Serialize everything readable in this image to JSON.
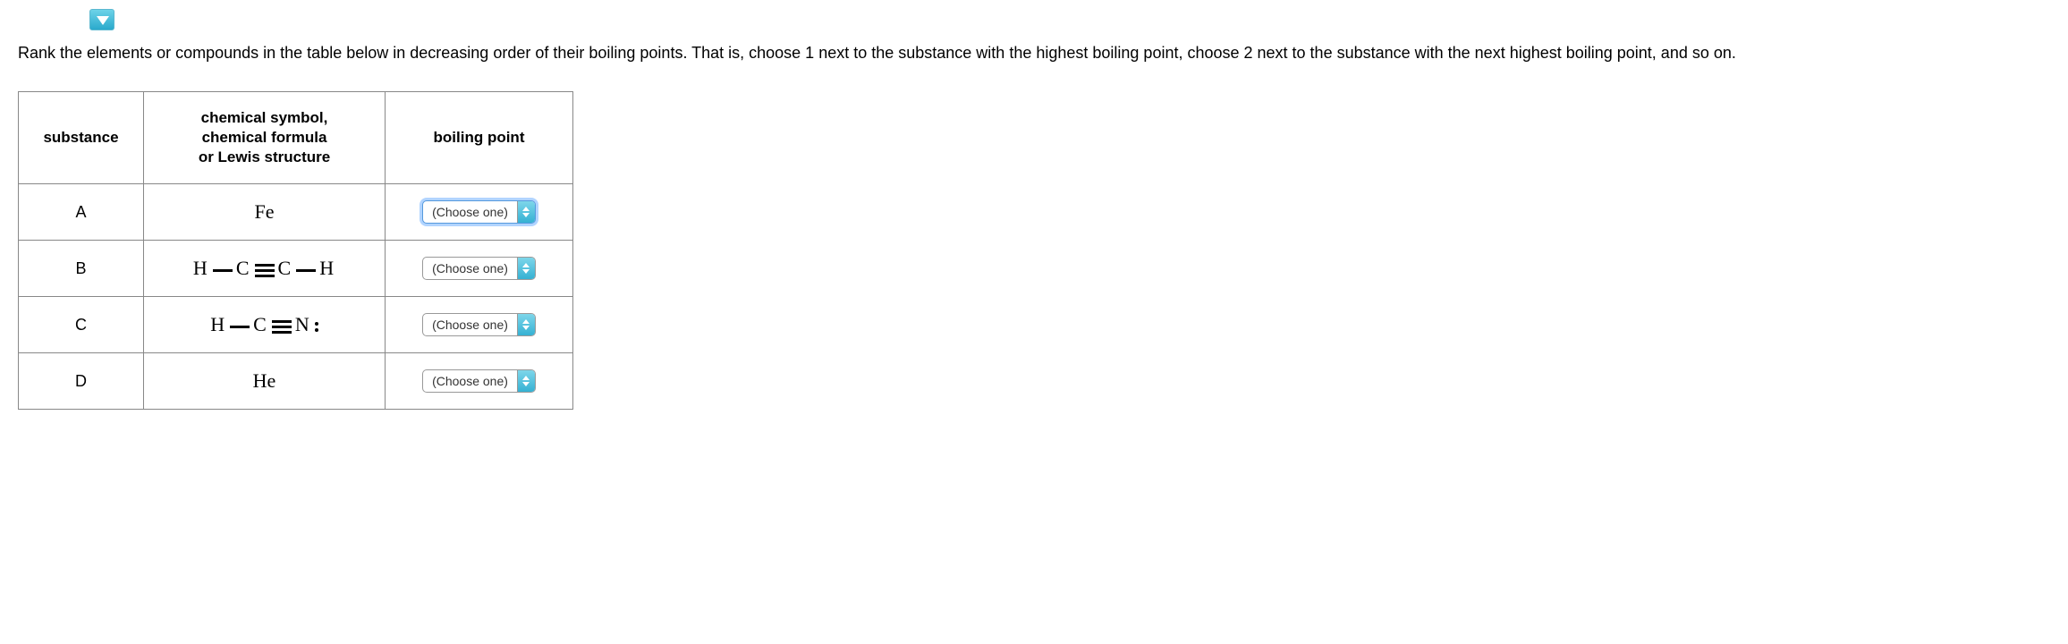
{
  "question": "Rank the elements or compounds in the table below in decreasing order of their boiling points. That is, choose 1 next to the substance with the highest boiling point, choose 2 next to the substance with the next highest boiling point, and so on.",
  "table": {
    "headers": {
      "substance": "substance",
      "formula": "chemical symbol,\nchemical formula\nor Lewis structure",
      "formula_line1": "chemical symbol,",
      "formula_line2": "chemical formula",
      "formula_line3": "or Lewis structure",
      "bp": "boiling point"
    },
    "rows": [
      {
        "substance": "A",
        "formula_type": "text",
        "formula": "Fe",
        "select_label": "(Choose one)",
        "focused": true
      },
      {
        "substance": "B",
        "formula_type": "lewis_hcch",
        "formula": "H — C ≡ C — H",
        "select_label": "(Choose one)",
        "focused": false
      },
      {
        "substance": "C",
        "formula_type": "lewis_hcn",
        "formula": "H — C ≡ N :",
        "select_label": "(Choose one)",
        "focused": false
      },
      {
        "substance": "D",
        "formula_type": "text",
        "formula": "He",
        "select_label": "(Choose one)",
        "focused": false
      }
    ]
  }
}
